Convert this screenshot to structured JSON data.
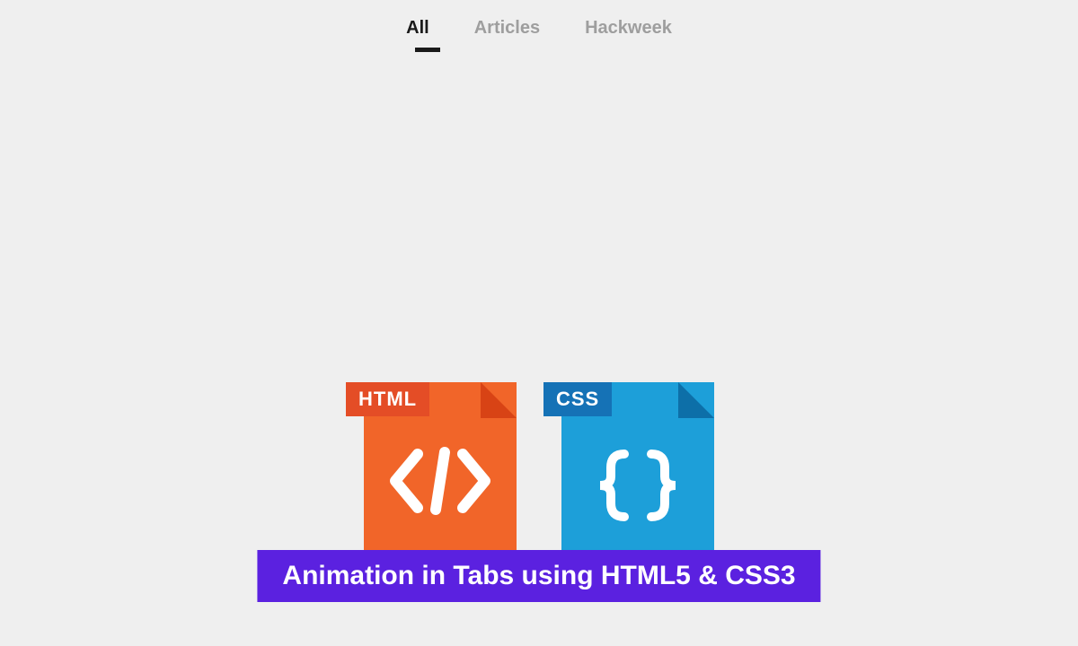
{
  "tabs": [
    {
      "label": "All",
      "active": true
    },
    {
      "label": "Articles",
      "active": false
    },
    {
      "label": "Hackweek",
      "active": false
    }
  ],
  "icons": {
    "html": {
      "label": "HTML",
      "symbol": "</>"
    },
    "css": {
      "label": "CSS",
      "symbol": "{ }"
    }
  },
  "banner": {
    "title": "Animation in Tabs using HTML5 & CSS3"
  },
  "colors": {
    "html_body": "#f16529",
    "html_label": "#e44d26",
    "css_body": "#1d9fd9",
    "css_label": "#1572b6",
    "banner": "#5b21e0"
  }
}
